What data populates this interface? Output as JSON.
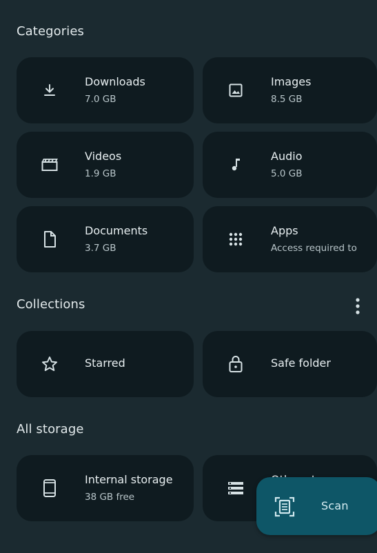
{
  "sections": {
    "categories_title": "Categories",
    "collections_title": "Collections",
    "all_storage_title": "All storage"
  },
  "categories": [
    {
      "label": "Downloads",
      "sub": "7.0 GB",
      "icon": "download-icon"
    },
    {
      "label": "Images",
      "sub": "8.5 GB",
      "icon": "image-icon"
    },
    {
      "label": "Videos",
      "sub": "1.9 GB",
      "icon": "video-clapper-icon"
    },
    {
      "label": "Audio",
      "sub": "5.0 GB",
      "icon": "music-note-icon"
    },
    {
      "label": "Documents",
      "sub": "3.7 GB",
      "icon": "document-icon"
    },
    {
      "label": "Apps",
      "sub": "Access required to",
      "icon": "apps-grid-icon"
    }
  ],
  "collections": [
    {
      "label": "Starred",
      "icon": "star-icon"
    },
    {
      "label": "Safe folder",
      "icon": "lock-icon"
    }
  ],
  "storage": [
    {
      "label": "Internal storage",
      "sub": "38 GB free",
      "icon": "phone-icon"
    },
    {
      "label": "Other st",
      "icon": "storage-list-icon"
    }
  ],
  "fab": {
    "label": "Scan",
    "icon": "document-scan-icon"
  },
  "colors": {
    "background": "#1b2a30",
    "card": "#0f1b20",
    "fab": "#0e5667"
  }
}
